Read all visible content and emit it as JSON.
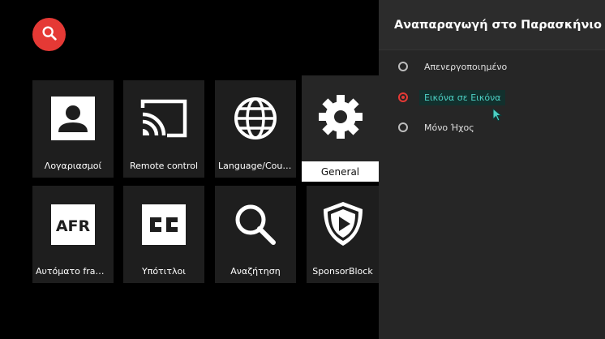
{
  "search": {
    "icon": "search-icon"
  },
  "tiles": [
    {
      "label": "Λογαριασμοί",
      "icon": "account-icon"
    },
    {
      "label": "Remote control",
      "icon": "cast-icon"
    },
    {
      "label": "Language/Country",
      "icon": "globe-icon"
    },
    {
      "label": "General",
      "icon": "gear-icon"
    },
    {
      "label": "Αυτόματο frame…",
      "icon": "afr-icon"
    },
    {
      "label": "Υπότιτλοι",
      "icon": "closed-captions-icon"
    },
    {
      "label": "Αναζήτηση",
      "icon": "search-icon"
    },
    {
      "label": "SponsorBlock",
      "icon": "sponsorblock-shield-icon"
    }
  ],
  "panel": {
    "title": "Αναπαραγωγή στο Παρασκήνιο",
    "options": [
      {
        "label": "Απενεργοποιημένο",
        "selected": false
      },
      {
        "label": "Εικόνα σε Εικόνα",
        "selected": true
      },
      {
        "label": "Μόνο Ήχος",
        "selected": false
      }
    ]
  },
  "colors": {
    "accent": "#e53935",
    "focus_text": "#4dd0c4",
    "panel_bg": "#262626",
    "tile_bg": "#1e1e1e"
  }
}
